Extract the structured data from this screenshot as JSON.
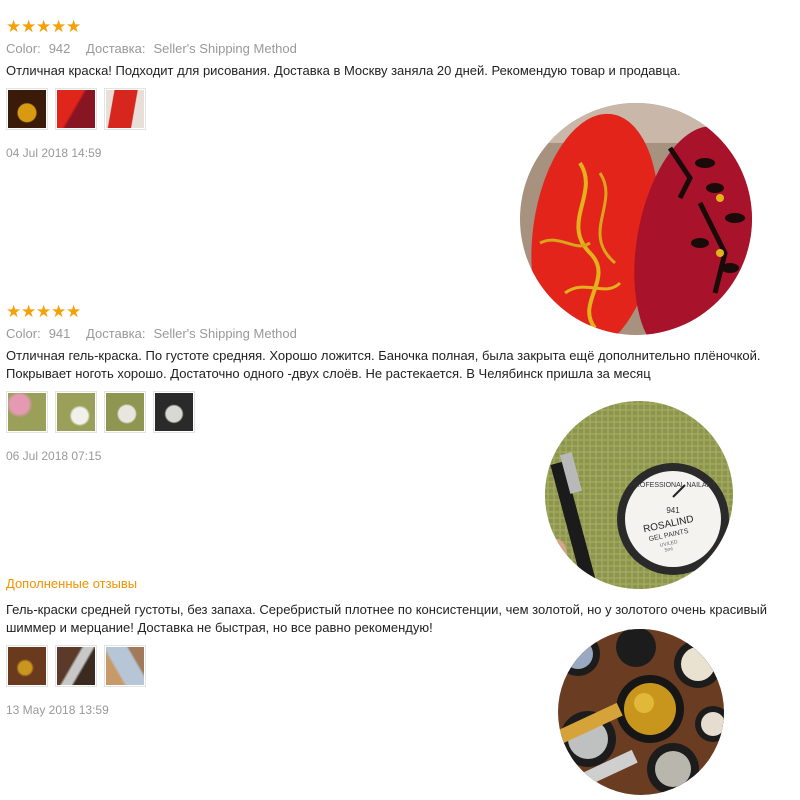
{
  "reviews": [
    {
      "color_label": "Color:",
      "color_value": "942",
      "shipping_label": "Доставка:",
      "shipping_value": "Seller's Shipping Method",
      "text": "Отличная краска! Подходит для рисования. Доставка в Москву заняла 20 дней. Рекомендую товар и продавца.",
      "date": "04 Jul 2018 14:59",
      "rating": 5
    },
    {
      "color_label": "Color:",
      "color_value": "941",
      "shipping_label": "Доставка:",
      "shipping_value": "Seller's Shipping Method",
      "text": "Отличная гель-краска. По густоте средняя. Хорошо ложится. Баночка полная, была закрыта ещё дополнительно плёночкой. Покрывает ноготь хорошо. Достаточно одного -двух слоёв. Не растекается. В Челябинск пришла за месяц",
      "date": "06 Jul 2018 07:15",
      "rating": 5
    }
  ],
  "additional": {
    "label": "Дополненные отзывы",
    "text": "Гель-краски средней густоты, без запаха. Серебристый плотнее по консистенции, чем золотой, но у золотого очень красивый шиммер и мерцание! Доставка не быстрая, но все равно рекомендую!",
    "date": "13 May 2018 13:59"
  },
  "jar_label": {
    "brand_top": "PROFESSIONAL NAILART",
    "number": "941",
    "brand": "ROSALIND",
    "product": "GEL PAINTS",
    "variant": "UV/LED",
    "volume": "5ml"
  },
  "colors": {
    "star": "#f4a10a",
    "accent_orange": "#f29100",
    "meta_gray": "#999999"
  }
}
